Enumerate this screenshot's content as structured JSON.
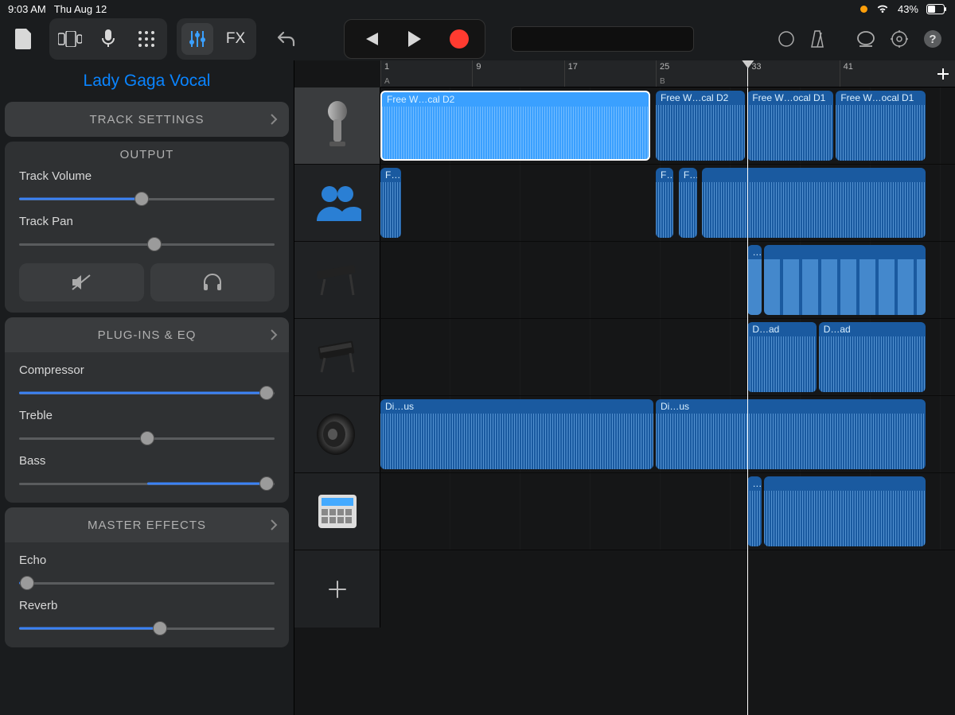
{
  "status": {
    "time": "9:03 AM",
    "date": "Thu Aug 12",
    "battery": "43%"
  },
  "track_name": "Lady Gaga Vocal",
  "sections": {
    "track_settings": "TRACK SETTINGS",
    "output": "OUTPUT",
    "track_volume_label": "Track Volume",
    "track_pan_label": "Track Pan",
    "plugins": "PLUG-INS & EQ",
    "compressor_label": "Compressor",
    "treble_label": "Treble",
    "bass_label": "Bass",
    "master": "MASTER EFFECTS",
    "echo_label": "Echo",
    "reverb_label": "Reverb"
  },
  "sliders": {
    "track_volume": 48,
    "track_pan": 53,
    "compressor": 97,
    "treble": 50,
    "bass": 97,
    "echo": 3,
    "reverb": 55
  },
  "fx_label": "FX",
  "ruler": {
    "bars": [
      {
        "num": "1",
        "sub": "A"
      },
      {
        "num": "9",
        "sub": ""
      },
      {
        "num": "17",
        "sub": ""
      },
      {
        "num": "25",
        "sub": "B"
      },
      {
        "num": "33",
        "sub": ""
      },
      {
        "num": "41",
        "sub": ""
      }
    ]
  },
  "playhead_bar": 33,
  "tracks": [
    {
      "icon": "mic",
      "selected": true,
      "clips": [
        {
          "start": 1,
          "end": 24.5,
          "label": "Free W…cal D2",
          "style": "wave",
          "selected": true
        },
        {
          "start": 25,
          "end": 32.8,
          "label": "Free W…cal D2",
          "style": "wave",
          "dim": true
        },
        {
          "start": 33,
          "end": 40.5,
          "label": "Free W…ocal D1",
          "style": "wave",
          "dim": true
        },
        {
          "start": 40.7,
          "end": 48.5,
          "label": "Free W…ocal D1",
          "style": "wave",
          "dim": true
        }
      ]
    },
    {
      "icon": "group",
      "clips": [
        {
          "start": 1,
          "end": 2.8,
          "label": "Fr…s I",
          "style": "wave",
          "dim": true
        },
        {
          "start": 25,
          "end": 26.5,
          "label": "F…I",
          "style": "wave",
          "dim": true
        },
        {
          "start": 27,
          "end": 28.6,
          "label": "Fr…s I",
          "style": "wave",
          "dim": true
        },
        {
          "start": 29,
          "end": 48.5,
          "label": "",
          "style": "wave",
          "dim": true
        }
      ]
    },
    {
      "icon": "key1",
      "clips": [
        {
          "start": 33,
          "end": 34.2,
          "label": "…",
          "style": "block",
          "dim": true
        },
        {
          "start": 34.4,
          "end": 48.5,
          "label": "",
          "style": "block",
          "dim": true
        }
      ]
    },
    {
      "icon": "key2",
      "clips": [
        {
          "start": 33,
          "end": 39,
          "label": "D…ad",
          "style": "wave",
          "dim": true
        },
        {
          "start": 39.2,
          "end": 48.5,
          "label": "D…ad",
          "style": "wave",
          "dim": true
        }
      ]
    },
    {
      "icon": "speaker",
      "clips": [
        {
          "start": 1,
          "end": 24.8,
          "label": "Di…us",
          "style": "wave",
          "dim": true
        },
        {
          "start": 25,
          "end": 48.5,
          "label": "Di…us",
          "style": "wave",
          "dim": true
        }
      ]
    },
    {
      "icon": "drum",
      "clips": [
        {
          "start": 33,
          "end": 34.2,
          "label": "…",
          "style": "wave",
          "dim": true
        },
        {
          "start": 34.4,
          "end": 48.5,
          "label": "",
          "style": "wave",
          "dim": true
        }
      ]
    }
  ]
}
